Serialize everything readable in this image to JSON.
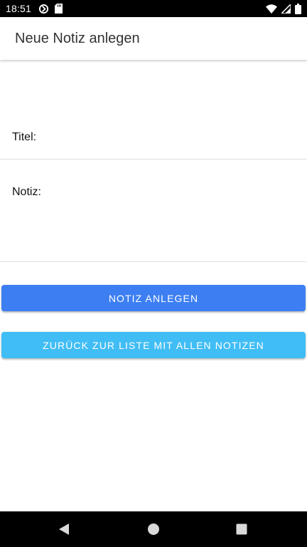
{
  "status_bar": {
    "time": "18:51",
    "icons": [
      "sync-icon",
      "sd-card-icon",
      "wifi-icon",
      "signal-icon",
      "battery-icon"
    ]
  },
  "app_bar": {
    "title": "Neue Notiz anlegen"
  },
  "form": {
    "title_label": "Titel:",
    "title_value": "",
    "note_label": "Notiz:",
    "note_value": ""
  },
  "buttons": {
    "create_label": "NOTIZ ANLEGEN",
    "back_label": "ZURÜCK ZUR LISTE MIT ALLEN NOTIZEN"
  },
  "nav_bar": {
    "icons": [
      "back-triangle-icon",
      "home-circle-icon",
      "recents-square-icon"
    ]
  },
  "colors": {
    "create_button": "#3d7ff2",
    "back_button": "#40bdf5",
    "status_bar": "#000000",
    "nav_bar": "#000000"
  }
}
